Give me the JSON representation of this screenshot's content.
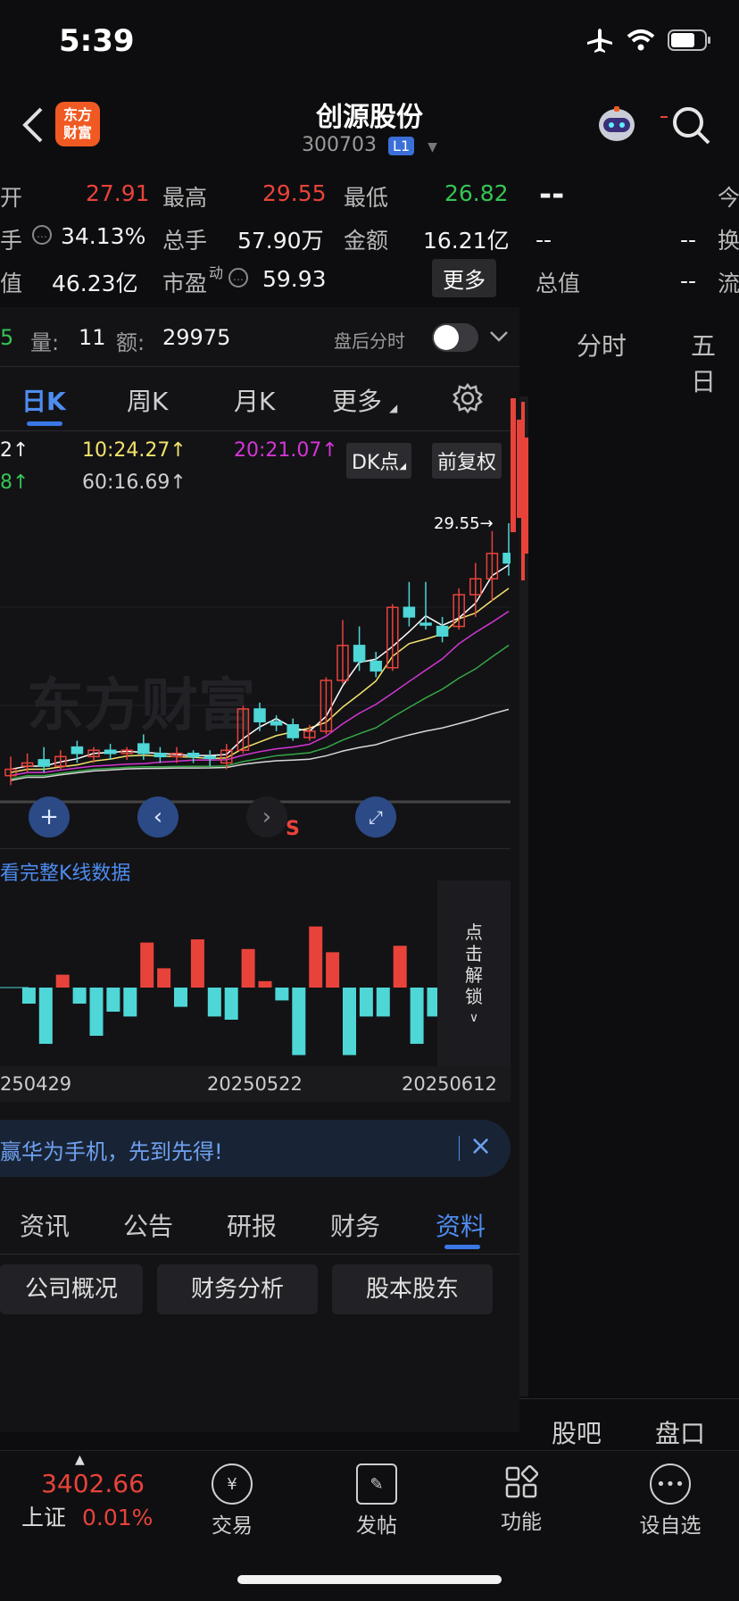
{
  "status_bar": {
    "time": "5:39"
  },
  "header": {
    "title": "创源股份",
    "code": "300703",
    "level_badge": "L1",
    "logo_text_1": "东方",
    "logo_text_2": "财富"
  },
  "quote": {
    "row1": [
      {
        "label": "开",
        "value": "27.91",
        "color": "red"
      },
      {
        "label": "最高",
        "value": "29.55",
        "color": "red"
      },
      {
        "label": "最低",
        "value": "26.82",
        "color": "green"
      }
    ],
    "row2": [
      {
        "label": "手",
        "value": "34.13%"
      },
      {
        "label": "总手",
        "value": "57.90万"
      },
      {
        "label": "金额",
        "value": "16.21亿"
      }
    ],
    "row3": [
      {
        "label": "值",
        "value": "46.23亿"
      },
      {
        "label": "市盈",
        "sup": "动",
        "value": "59.93"
      }
    ],
    "more_label": "更多",
    "right_col": {
      "dash_big": "--",
      "row2_a": "--",
      "row2_b": "--",
      "row3_label": "总值",
      "row3_value": "--",
      "edge1": "今",
      "edge2": "换",
      "edge3": "流"
    }
  },
  "tick_row": {
    "prefix": "5",
    "vol_label": "量:",
    "vol_value": "11",
    "amt_label": "额:",
    "amt_value": "29975",
    "after_hours_label": "盘后分时"
  },
  "right_tabs": {
    "fenshi": "分时",
    "wuri": "五日"
  },
  "k_tabs": [
    "日K",
    "周K",
    "月K",
    "更多"
  ],
  "ma": {
    "m5": "2",
    "m10": "10:24.27",
    "m20": "20:21.07",
    "m30": "8",
    "m60": "60:16.69",
    "dk_label": "DK点",
    "fq_label": "前复权"
  },
  "chart_data": {
    "type": "candlestick",
    "high_marker": "29.55",
    "watermark": "东方财富",
    "x_labels": [
      "250429",
      "20250522",
      "20250612"
    ],
    "candles": [
      {
        "o": 21.6,
        "c": 21.8,
        "h": 22.2,
        "l": 21.3,
        "up": true
      },
      {
        "o": 21.9,
        "c": 22.0,
        "h": 22.3,
        "l": 21.7,
        "up": true
      },
      {
        "o": 22.1,
        "c": 21.9,
        "h": 22.5,
        "l": 21.7,
        "up": false
      },
      {
        "o": 21.9,
        "c": 22.2,
        "h": 22.4,
        "l": 21.8,
        "up": true
      },
      {
        "o": 22.5,
        "c": 22.3,
        "h": 22.7,
        "l": 22.0,
        "up": false
      },
      {
        "o": 22.2,
        "c": 22.4,
        "h": 22.5,
        "l": 22.0,
        "up": true
      },
      {
        "o": 22.4,
        "c": 22.3,
        "h": 22.6,
        "l": 22.1,
        "up": false
      },
      {
        "o": 22.3,
        "c": 22.4,
        "h": 22.5,
        "l": 22.1,
        "up": true
      },
      {
        "o": 22.6,
        "c": 22.3,
        "h": 22.9,
        "l": 22.1,
        "up": false
      },
      {
        "o": 22.3,
        "c": 22.2,
        "h": 22.5,
        "l": 22.0,
        "up": false
      },
      {
        "o": 22.2,
        "c": 22.3,
        "h": 22.5,
        "l": 22.0,
        "up": true
      },
      {
        "o": 22.3,
        "c": 22.2,
        "h": 22.4,
        "l": 22.0,
        "up": false
      },
      {
        "o": 22.2,
        "c": 22.2,
        "h": 22.4,
        "l": 21.9,
        "up": false
      },
      {
        "o": 22.0,
        "c": 22.4,
        "h": 22.6,
        "l": 21.8,
        "up": true
      },
      {
        "o": 22.4,
        "c": 23.7,
        "h": 23.8,
        "l": 22.3,
        "up": true
      },
      {
        "o": 23.7,
        "c": 23.3,
        "h": 23.9,
        "l": 23.0,
        "up": false
      },
      {
        "o": 23.3,
        "c": 23.2,
        "h": 23.5,
        "l": 23.0,
        "up": false
      },
      {
        "o": 23.2,
        "c": 22.8,
        "h": 23.4,
        "l": 22.7,
        "up": false
      },
      {
        "o": 22.8,
        "c": 23.0,
        "h": 23.2,
        "l": 22.7,
        "up": true
      },
      {
        "o": 23.0,
        "c": 24.6,
        "h": 24.7,
        "l": 22.9,
        "up": true
      },
      {
        "o": 24.6,
        "c": 25.7,
        "h": 26.5,
        "l": 24.5,
        "up": true
      },
      {
        "o": 25.7,
        "c": 25.2,
        "h": 26.3,
        "l": 24.9,
        "up": false
      },
      {
        "o": 25.2,
        "c": 24.9,
        "h": 25.5,
        "l": 24.7,
        "up": false
      },
      {
        "o": 25.0,
        "c": 26.9,
        "h": 27.0,
        "l": 24.9,
        "up": true
      },
      {
        "o": 26.9,
        "c": 26.6,
        "h": 27.7,
        "l": 26.3,
        "up": false
      },
      {
        "o": 26.4,
        "c": 26.4,
        "h": 27.7,
        "l": 26.2,
        "up": false
      },
      {
        "o": 26.3,
        "c": 26.0,
        "h": 26.6,
        "l": 25.8,
        "up": false
      },
      {
        "o": 26.3,
        "c": 27.3,
        "h": 27.5,
        "l": 26.2,
        "up": true
      },
      {
        "o": 27.3,
        "c": 27.8,
        "h": 28.3,
        "l": 26.6,
        "up": true
      },
      {
        "o": 27.8,
        "c": 28.6,
        "h": 29.3,
        "l": 27.1,
        "up": true
      },
      {
        "o": 28.6,
        "c": 28.3,
        "h": 29.55,
        "l": 27.9,
        "up": false
      }
    ],
    "volume_bars": [
      0,
      -1,
      -3.5,
      0.8,
      -1.0,
      -3.0,
      -1.5,
      -1.8,
      2.8,
      1.2,
      -1.2,
      3.0,
      -1.8,
      -2.0,
      2.4,
      0.4,
      -0.8,
      -4.2,
      3.8,
      2.2,
      -4.2,
      -1.8,
      -1.8,
      2.6,
      -3.5,
      -1.8,
      -4.4
    ],
    "x_range": [
      0,
      31
    ],
    "y_range": [
      21.0,
      30.0
    ]
  },
  "chart_controls": {
    "s_marker": "S"
  },
  "view_full_k": "看完整K线数据",
  "unlock_label": [
    "点",
    "击",
    "解",
    "锁"
  ],
  "ad": {
    "text": "赢华为手机，先到先得!",
    "close": "×"
  },
  "info_tabs": [
    "资讯",
    "公告",
    "研报",
    "财务",
    "资料"
  ],
  "info_subtabs": [
    "公司概况",
    "财务分析",
    "股本股东"
  ],
  "right_bottom_tabs": [
    "股吧",
    "盘口"
  ],
  "nav": {
    "index_value": "3402.66",
    "index_name": "上证",
    "index_change": "0.01%",
    "items": [
      "交易",
      "发帖",
      "功能",
      "设自选"
    ],
    "icons": [
      "yen-icon",
      "pencil-icon",
      "grid-icon",
      "more-dots-icon"
    ]
  }
}
